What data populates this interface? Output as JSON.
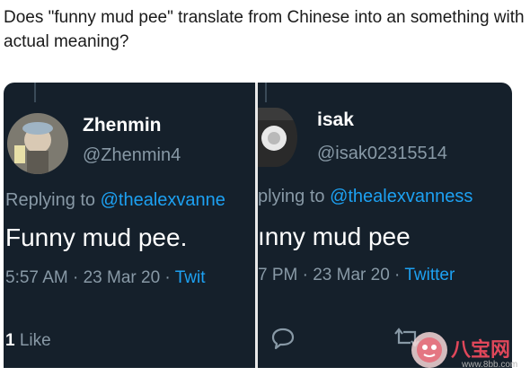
{
  "question": "Does \"funny mud pee\" translate from Chinese into an something with actual meaning?",
  "left_tweet": {
    "name": "Zhenmin",
    "handle": "@Zhenmin4",
    "reply_prefix": "Replying to ",
    "reply_mention": "@thealexvanne",
    "text": "Funny mud pee.",
    "meta_time": "5:57 AM · 23 Mar 20 · ",
    "meta_source": "Twit",
    "likes_count": "1",
    "likes_label": " Like"
  },
  "right_tweet": {
    "name": "isak",
    "handle": "@isak02315514",
    "reply_prefix": "plying to ",
    "reply_mention": "@thealexvanness",
    "text": "ınny mud pee",
    "meta_time": "7 PM · 23 Mar 20 · ",
    "meta_source": "Twitter"
  },
  "watermark": {
    "text": "八宝网",
    "url": "www.8bb.com"
  },
  "colors": {
    "background": "#15202b",
    "link": "#1da1f2",
    "muted": "#8899a6"
  }
}
